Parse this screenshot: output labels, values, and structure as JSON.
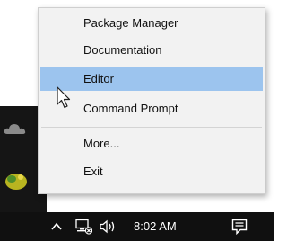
{
  "context_menu": {
    "items": [
      {
        "label": "Package Manager"
      },
      {
        "label": "Documentation"
      },
      {
        "label": "Editor",
        "highlighted": true
      },
      {
        "label": "Command Prompt"
      },
      {
        "label": "More..."
      },
      {
        "label": "Exit"
      }
    ],
    "highlight_color": "#9cc4ee"
  },
  "taskbar": {
    "time": "8:02 AM",
    "icons": [
      "chevron-up-icon",
      "network-icon",
      "volume-icon",
      "notification-icon"
    ]
  },
  "desktop_icons": [
    "cloud-icon",
    "shell-icon"
  ]
}
